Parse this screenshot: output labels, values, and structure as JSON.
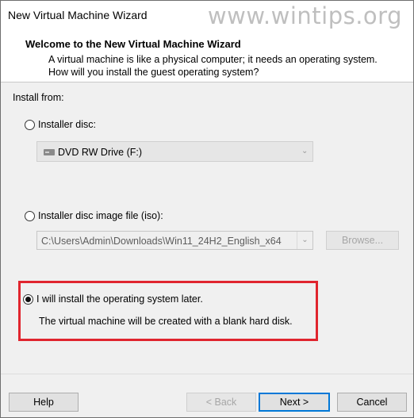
{
  "window": {
    "title": "New Virtual Machine Wizard",
    "watermark": "www.wintips.org"
  },
  "header": {
    "title": "Welcome to the New Virtual Machine Wizard",
    "description": "A virtual machine is like a physical computer; it needs an operating system. How will you install the guest operating system?"
  },
  "install": {
    "section_label": "Install from:",
    "options": [
      {
        "label": "Installer disc:",
        "selected": false
      },
      {
        "label": "Installer disc image file (iso):",
        "selected": false
      },
      {
        "label": "I will install the operating system later.",
        "selected": true
      }
    ],
    "disc_drive": "DVD RW Drive (F:)",
    "iso_path": "C:\\Users\\Admin\\Downloads\\Win11_24H2_English_x64",
    "browse_label": "Browse...",
    "later_note": "The virtual machine will be created with a blank hard disk."
  },
  "footer": {
    "help_label": "Help",
    "back_label": "< Back",
    "next_label": "Next >",
    "cancel_label": "Cancel"
  },
  "colors": {
    "highlight_border": "#e0252e",
    "default_button_border": "#0078d7"
  }
}
